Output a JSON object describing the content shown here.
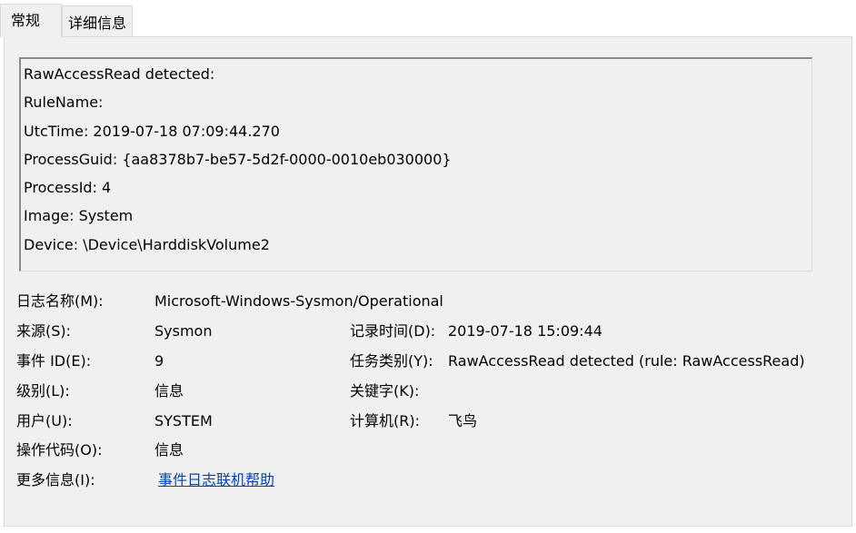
{
  "tabs": [
    {
      "label": "常规"
    },
    {
      "label": "详细信息"
    }
  ],
  "description": {
    "lines": [
      "RawAccessRead detected:",
      "RuleName: ",
      "UtcTime: 2019-07-18 07:09:44.270",
      "ProcessGuid: {aa8378b7-be57-5d2f-0000-0010eb030000}",
      "ProcessId: 4",
      "Image: System",
      "Device: \\Device\\HarddiskVolume2"
    ]
  },
  "fields": {
    "log_name": {
      "label": "日志名称(M):",
      "value": "Microsoft-Windows-Sysmon/Operational"
    },
    "source": {
      "label": "来源(S):",
      "value": "Sysmon"
    },
    "logged": {
      "label": "记录时间(D):",
      "value": "2019-07-18 15:09:44"
    },
    "event_id": {
      "label": "事件 ID(E):",
      "value": "9"
    },
    "task_category": {
      "label": "任务类别(Y):",
      "value": "RawAccessRead detected (rule: RawAccessRead)"
    },
    "level": {
      "label": "级别(L):",
      "value": "信息"
    },
    "keywords": {
      "label": "关键字(K):",
      "value": ""
    },
    "user": {
      "label": "用户(U):",
      "value": "SYSTEM"
    },
    "computer": {
      "label": "计算机(R):",
      "value": "飞鸟"
    },
    "opcode": {
      "label": "操作代码(O):",
      "value": "信息"
    },
    "more_info": {
      "label": "更多信息(I):",
      "value": "事件日志联机帮助"
    }
  }
}
